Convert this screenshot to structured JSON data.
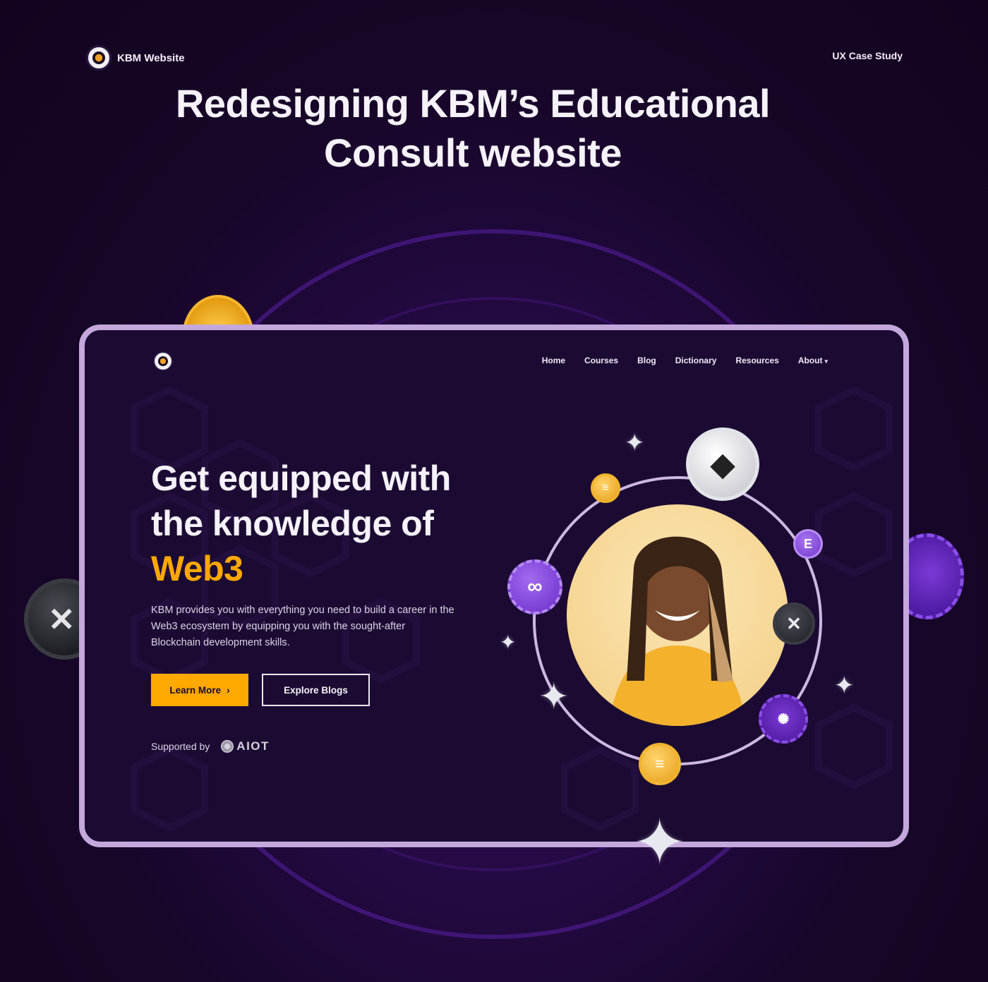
{
  "header": {
    "brand_label": "KBM Website",
    "case_study_label": "UX Case Study",
    "title_line1": "Redesigning KBM’s Educational",
    "title_line2": "Consult website"
  },
  "site": {
    "nav": [
      {
        "label": "Home"
      },
      {
        "label": "Courses"
      },
      {
        "label": "Blog"
      },
      {
        "label": "Dictionary"
      },
      {
        "label": "Resources"
      },
      {
        "label": "About"
      }
    ],
    "headline_line1": "Get equipped with",
    "headline_line2": "the knowledge of",
    "headline_accent": "Web3",
    "description": "KBM provides you with everything you need to build a career in the Web3 ecosystem by equipping you with the sought-after Blockchain development skills.",
    "primary_button": "Learn More",
    "secondary_button": "Explore Blogs",
    "supported_label": "Supported by",
    "supporter_name": "AIOT"
  },
  "icons": {
    "logo": "kbm-logo-icon",
    "chevron": "chevron-down-icon",
    "arrow": "chevron-right-icon",
    "coins": [
      "ethereum-coin-icon",
      "solana-coin-icon",
      "enjin-coin-icon",
      "polygon-coin-icon",
      "xrp-coin-icon",
      "cardano-coin-icon"
    ],
    "sparkle": "sparkle-star-icon"
  },
  "colors": {
    "background": "#170629",
    "frame_border": "#c4a8dc",
    "accent": "#ffa800",
    "text": "#f6f2fa"
  }
}
